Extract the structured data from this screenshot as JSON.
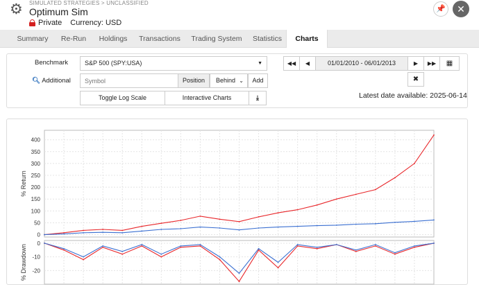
{
  "header": {
    "breadcrumb": "SIMULATED STRATEGIES > UNCLASSIFIED",
    "title": "Optimum Sim",
    "privacy": "Private",
    "currency": "Currency: USD"
  },
  "tabs": [
    {
      "label": "Summary"
    },
    {
      "label": "Re-Run"
    },
    {
      "label": "Holdings"
    },
    {
      "label": "Transactions"
    },
    {
      "label": "Trading System"
    },
    {
      "label": "Statistics"
    },
    {
      "label": "Charts",
      "active": true
    }
  ],
  "controls": {
    "benchmark_label": "Benchmark",
    "benchmark_value": "S&P 500 (SPY:USA)",
    "additional_label": "Additional",
    "symbol_placeholder": "Symbol",
    "position_label": "Position",
    "position_value": "Behind",
    "add_label": "Add",
    "toggle_log_label": "Toggle Log Scale",
    "interactive_label": "Interactive Charts",
    "date_range": "01/01/2010 - 06/01/2013",
    "latest_date": "Latest date available: 2025-06-14"
  },
  "colors": {
    "strategy": "#e8262a",
    "benchmark": "#3a6fd1"
  },
  "chart_data": [
    {
      "type": "line",
      "ylabel": "% Return",
      "ylim": [
        -10,
        440
      ],
      "yticks": [
        0,
        50,
        100,
        150,
        200,
        250,
        300,
        350,
        400
      ],
      "x": [
        0,
        5,
        10,
        15,
        20,
        25,
        30,
        35,
        40,
        45,
        50,
        55,
        60,
        65,
        70,
        75,
        80,
        85,
        90,
        95,
        100
      ],
      "series": [
        {
          "color": "#e8262a",
          "values": [
            0,
            8,
            18,
            22,
            18,
            35,
            48,
            60,
            78,
            65,
            55,
            75,
            92,
            105,
            125,
            150,
            170,
            190,
            240,
            300,
            420
          ]
        },
        {
          "color": "#3a6fd1",
          "values": [
            0,
            3,
            8,
            10,
            8,
            15,
            22,
            25,
            32,
            28,
            20,
            28,
            32,
            35,
            38,
            40,
            44,
            46,
            52,
            56,
            62
          ]
        }
      ]
    },
    {
      "type": "line",
      "ylabel": "% Drawdown",
      "ylim": [
        -30,
        2
      ],
      "yticks": [
        0,
        -10,
        -20
      ],
      "x": [
        0,
        5,
        10,
        15,
        20,
        25,
        30,
        35,
        40,
        45,
        50,
        55,
        60,
        65,
        70,
        75,
        80,
        85,
        90,
        95,
        100
      ],
      "series": [
        {
          "color": "#e8262a",
          "values": [
            0,
            -5,
            -12,
            -3,
            -8,
            -2,
            -10,
            -3,
            -2,
            -12,
            -28,
            -5,
            -18,
            -2,
            -4,
            -1,
            -6,
            -2,
            -8,
            -3,
            0
          ]
        },
        {
          "color": "#3a6fd1",
          "values": [
            0,
            -4,
            -10,
            -2,
            -6,
            -1,
            -8,
            -2,
            -1,
            -10,
            -22,
            -4,
            -14,
            -1,
            -3,
            -1,
            -5,
            -1,
            -7,
            -2,
            0
          ]
        }
      ]
    }
  ]
}
